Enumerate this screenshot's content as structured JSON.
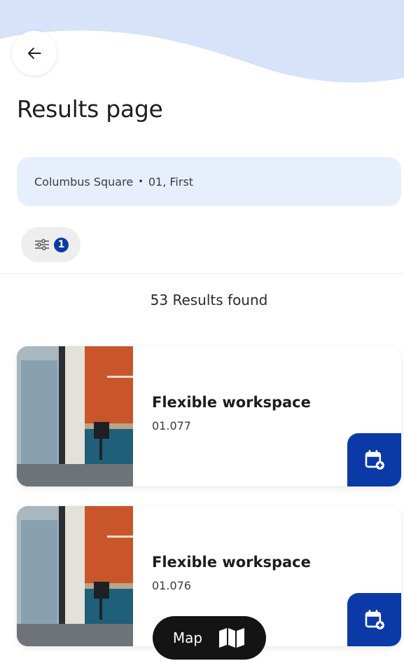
{
  "header": {
    "title": "Results page"
  },
  "location": {
    "building": "Columbus Square",
    "separator": "•",
    "floor": "01, First"
  },
  "filters": {
    "active_count": "1"
  },
  "results": {
    "count_text": "53 Results found"
  },
  "cards": [
    {
      "title": "Flexible workspace",
      "id": "01.077"
    },
    {
      "title": "Flexible workspace",
      "id": "01.076"
    }
  ],
  "map_button": {
    "label": "Map"
  },
  "colors": {
    "accent": "#0b3aa8",
    "wave": "#d6e3f8",
    "location_bg": "#e8effc"
  },
  "icons": {
    "back": "arrow-left-icon",
    "filter": "sliders-icon",
    "book": "calendar-plus-icon",
    "map": "map-icon"
  }
}
